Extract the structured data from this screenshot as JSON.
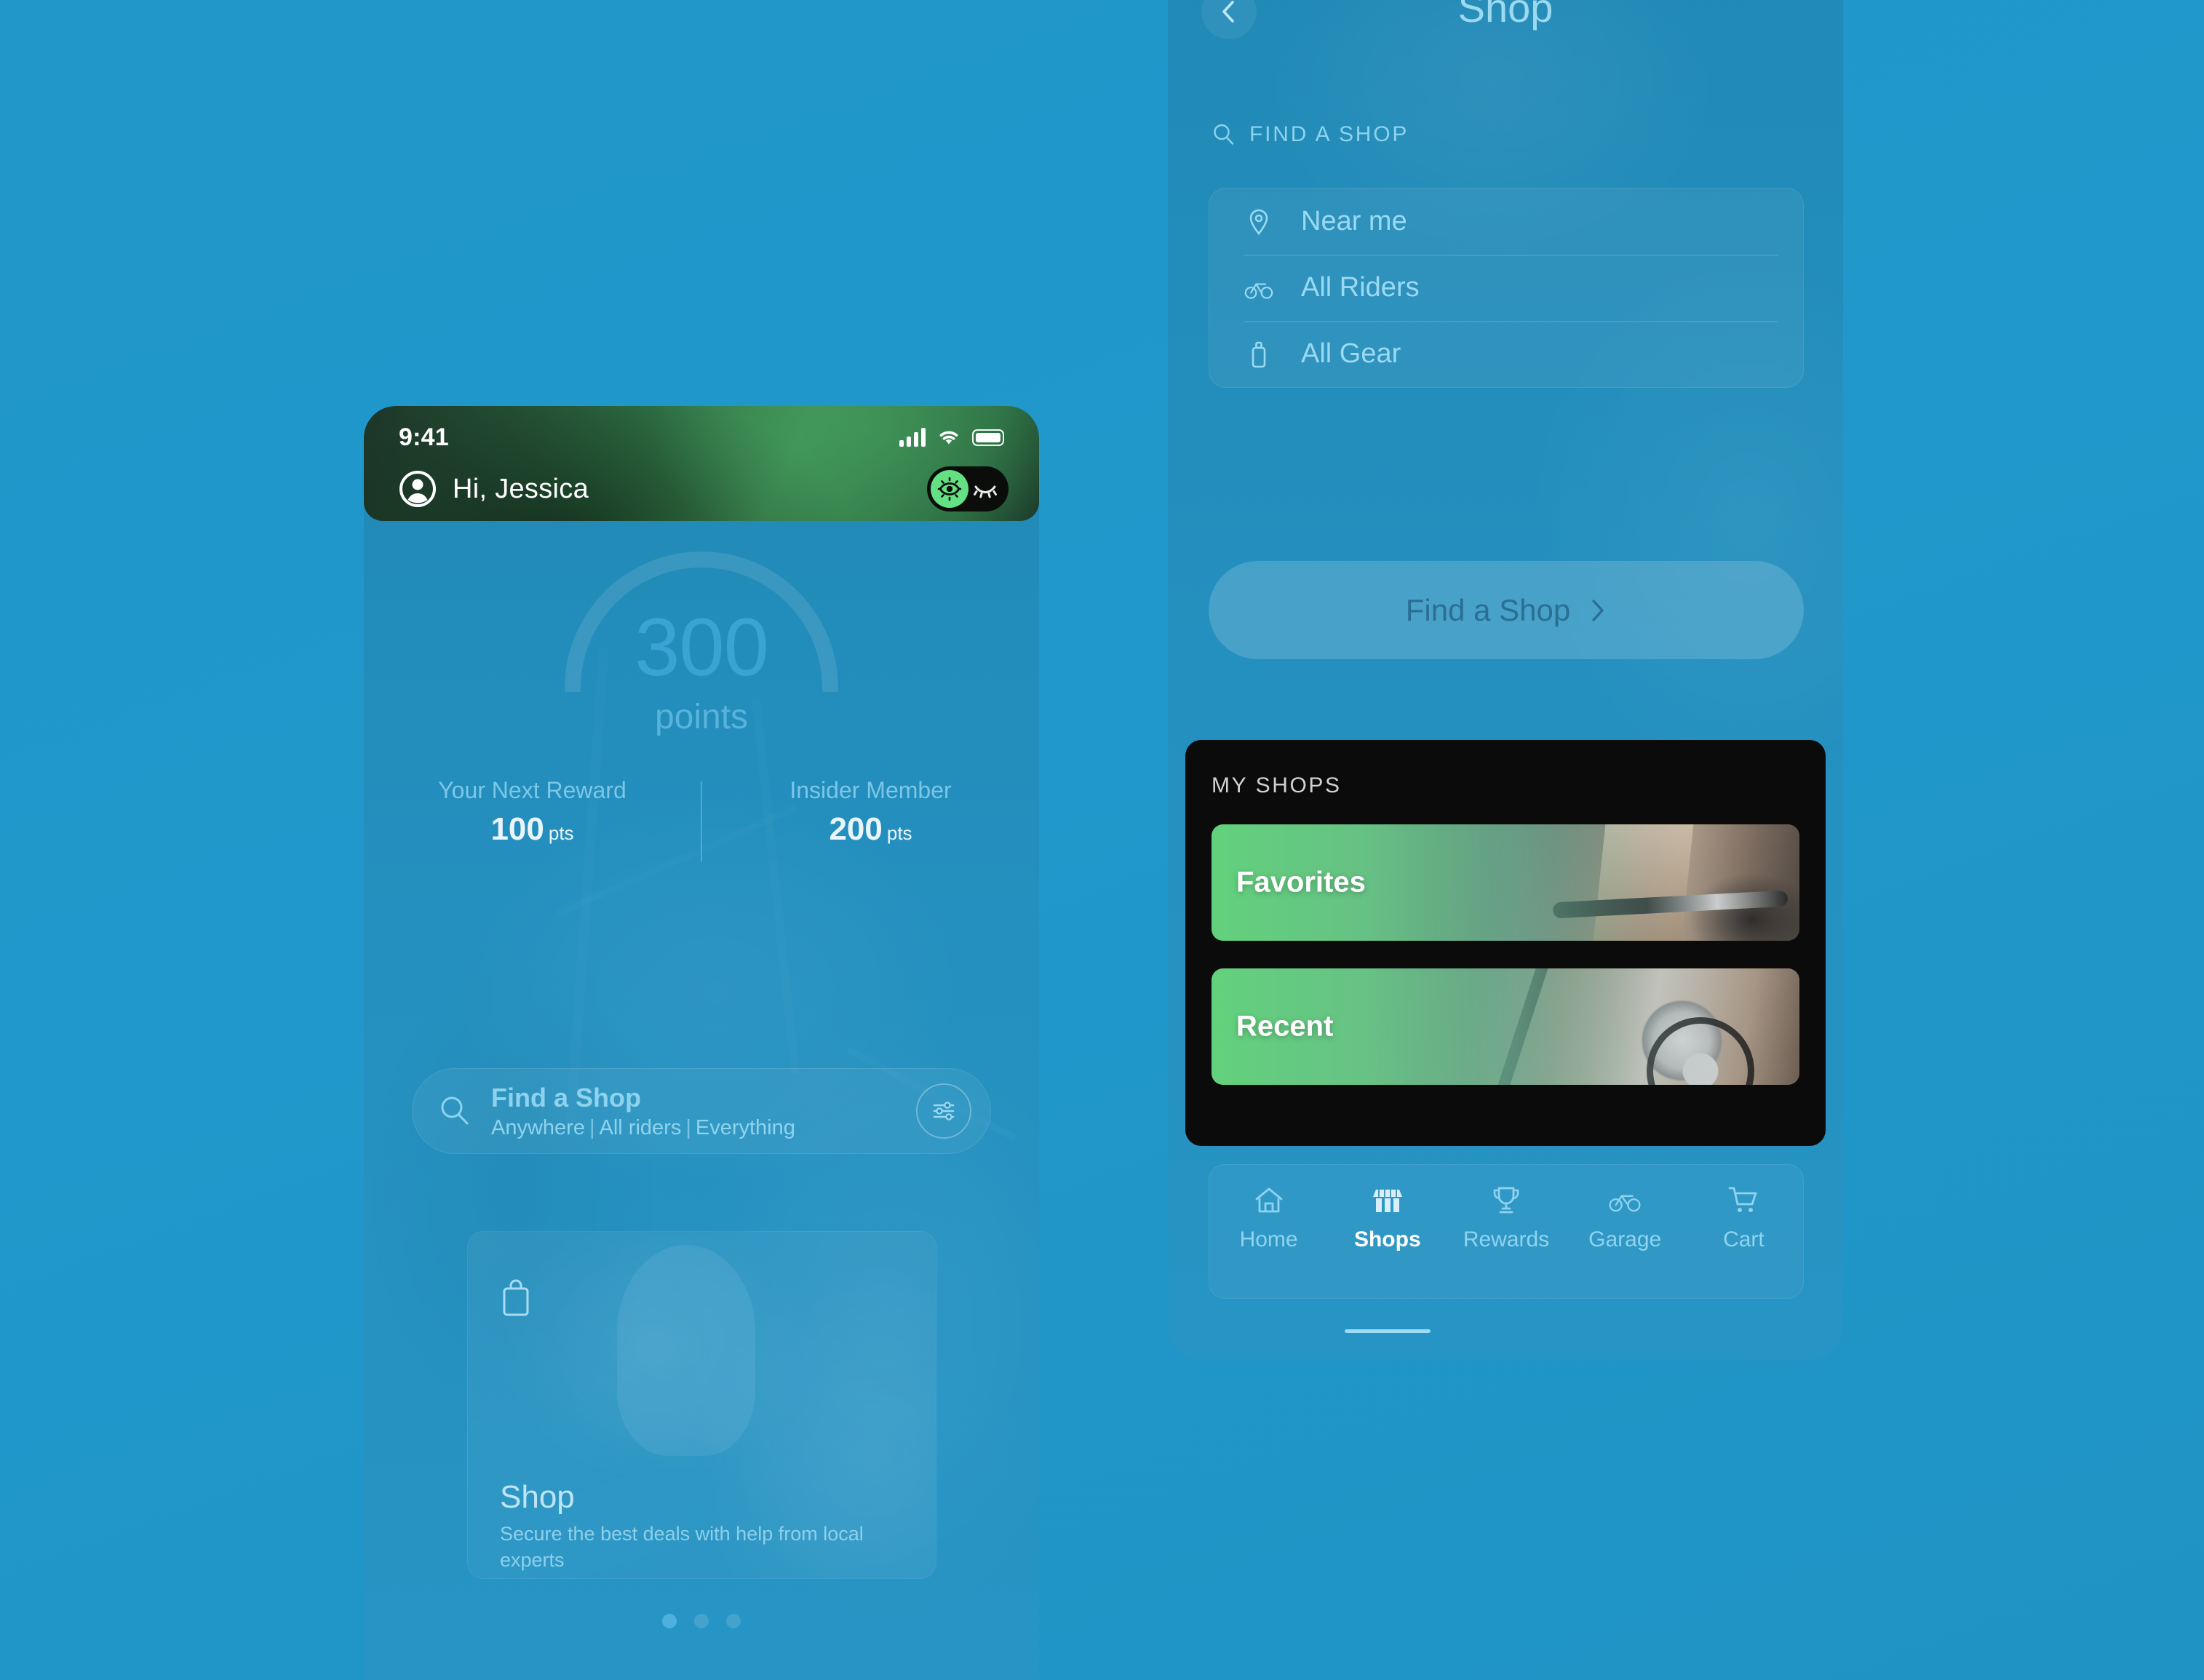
{
  "background_color": "#2096c9",
  "accent_green": "#63e183",
  "left_phone": {
    "status_bar": {
      "time": "9:41",
      "signal_icon": "signal-bars-icon",
      "wifi_icon": "wifi-icon",
      "battery_icon": "battery-icon"
    },
    "header": {
      "avatar_icon": "avatar-icon",
      "greeting": "Hi, Jessica",
      "toggle": {
        "on_icon": "eye-open-icon",
        "off_icon": "eye-closed-icon",
        "state": "on"
      }
    },
    "points": {
      "value": "300",
      "label": "points",
      "gauge_icon": "gauge-arc-icon"
    },
    "stats": [
      {
        "title": "Your Next Reward",
        "value": "100",
        "unit": "pts"
      },
      {
        "title": "Insider Member",
        "value": "200",
        "unit": "pts"
      }
    ],
    "search": {
      "icon": "search-icon",
      "title": "Find a Shop",
      "filters": [
        "Anywhere",
        "All riders",
        "Everything"
      ],
      "separator": "|",
      "filter_icon": "sliders-icon"
    },
    "shop_card": {
      "icon": "shopping-bag-icon",
      "title": "Shop",
      "subtitle": "Secure the best deals with help from local experts"
    },
    "pagination": {
      "total": 3,
      "active_index": 0
    }
  },
  "right_phone": {
    "title_bar": {
      "back_icon": "chevron-left-icon",
      "title": "Shop"
    },
    "find_label": {
      "icon": "search-icon",
      "text": "FIND A SHOP"
    },
    "options": [
      {
        "icon": "location-pin-icon",
        "label": "Near me"
      },
      {
        "icon": "bicycle-icon",
        "label": "All Riders"
      },
      {
        "icon": "gear-bottle-icon",
        "label": "All Gear"
      }
    ],
    "cta": {
      "label": "Find a Shop",
      "icon": "chevron-right-icon"
    },
    "my_shops": {
      "header": "MY SHOPS",
      "tiles": [
        {
          "label": "Favorites",
          "image": "cyclist-legs-handlebars-photo"
        },
        {
          "label": "Recent",
          "image": "bicycle-wheel-drivetrain-photo"
        }
      ]
    },
    "tab_bar": [
      {
        "icon": "home-icon",
        "label": "Home",
        "active": false
      },
      {
        "icon": "storefront-icon",
        "label": "Shops",
        "active": true
      },
      {
        "icon": "trophy-icon",
        "label": "Rewards",
        "active": false
      },
      {
        "icon": "bicycle-icon",
        "label": "Garage",
        "active": false
      },
      {
        "icon": "shopping-cart-icon",
        "label": "Cart",
        "active": false
      }
    ]
  }
}
